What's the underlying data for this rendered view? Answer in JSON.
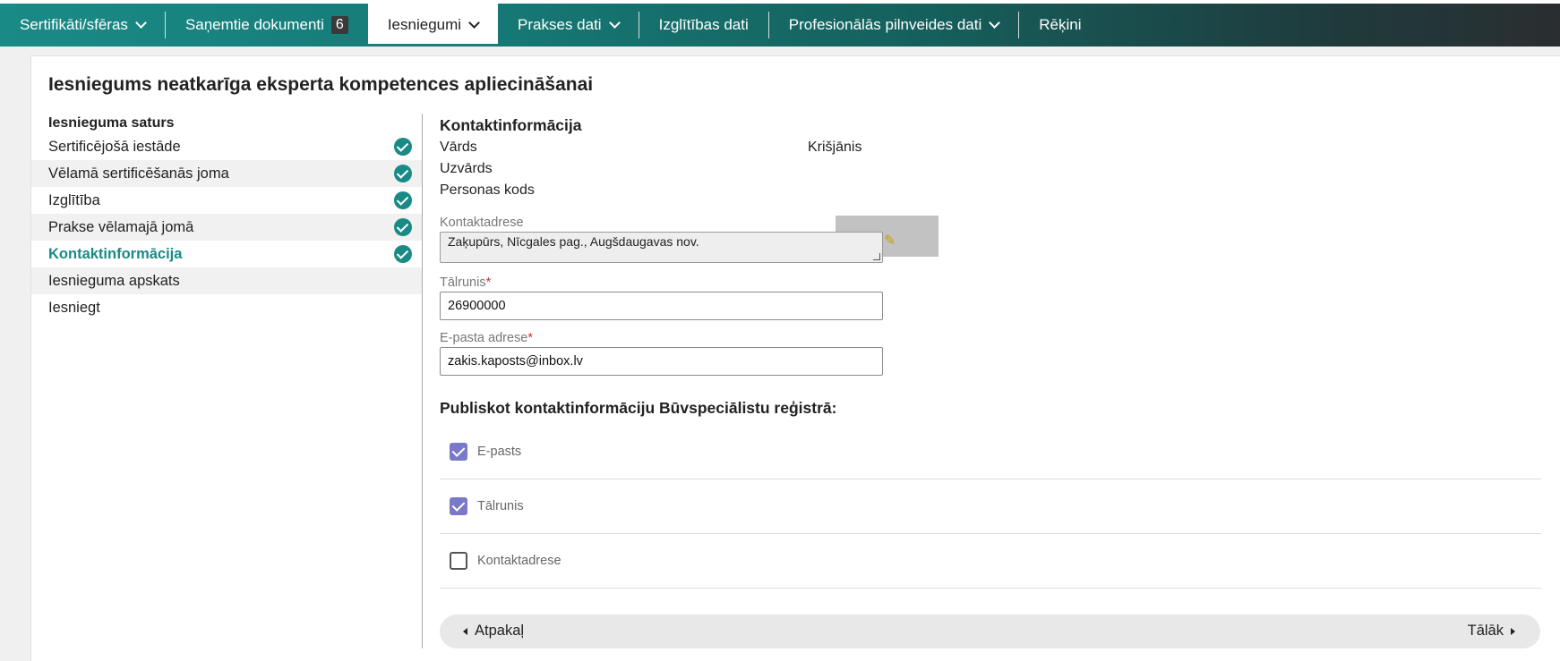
{
  "nav": {
    "items": [
      {
        "label": "Sertifikāti/sfēras",
        "has_dropdown": true
      },
      {
        "label": "Saņemtie dokumenti",
        "badge": "6"
      },
      {
        "label": "Iesniegumi",
        "has_dropdown": true,
        "active": true
      },
      {
        "label": "Prakses dati",
        "has_dropdown": true
      },
      {
        "label": "Izglītības dati"
      },
      {
        "label": "Profesionālās pilnveides dati",
        "has_dropdown": true
      },
      {
        "label": "Rēķini"
      }
    ]
  },
  "page": {
    "title": "Iesniegums neatkarīga eksperta kompetences apliecināšanai"
  },
  "sidebar": {
    "heading": "Iesnieguma saturs",
    "items": [
      {
        "label": "Sertificējošā iestāde",
        "completed": true
      },
      {
        "label": "Vēlamā sertificēšanās joma",
        "completed": true
      },
      {
        "label": "Izglītība",
        "completed": true
      },
      {
        "label": "Prakse vēlamajā jomā",
        "completed": true
      },
      {
        "label": "Kontaktinformācija",
        "completed": true,
        "current": true
      },
      {
        "label": "Iesnieguma apskats",
        "completed": false
      },
      {
        "label": "Iesniegt",
        "completed": false
      }
    ]
  },
  "contact": {
    "title": "Kontaktinformācija",
    "first_name_label": "Vārds",
    "first_name_value": "Krišjānis",
    "last_name_label": "Uzvārds",
    "personal_code_label": "Personas kods",
    "address_label": "Kontaktadrese",
    "address_value": "Zaķupūrs, Nīcgales pag., Augšdaugavas nov.",
    "phone_label": "Tālrunis",
    "phone_value": "26900000",
    "email_label": "E-pasta adrese",
    "email_value": "zakis.kaposts@inbox.lv",
    "required_mark": "*"
  },
  "publish": {
    "title": "Publiskot kontaktinformāciju Būvspeciālistu reģistrā:",
    "options": [
      {
        "label": "E-pasts",
        "checked": true
      },
      {
        "label": "Tālrunis",
        "checked": true
      },
      {
        "label": "Kontaktadrese",
        "checked": false
      }
    ]
  },
  "footer": {
    "back_label": "Atpakaļ",
    "next_label": "Tālāk"
  },
  "colors": {
    "accent": "#1a8a86",
    "checkbox_checked": "#7a78c8",
    "required": "#d03030"
  },
  "icons": {
    "check": "check-circle-icon",
    "edit": "pencil-icon",
    "back": "caret-left-icon",
    "next": "caret-right-icon",
    "dropdown": "chevron-down-icon"
  }
}
